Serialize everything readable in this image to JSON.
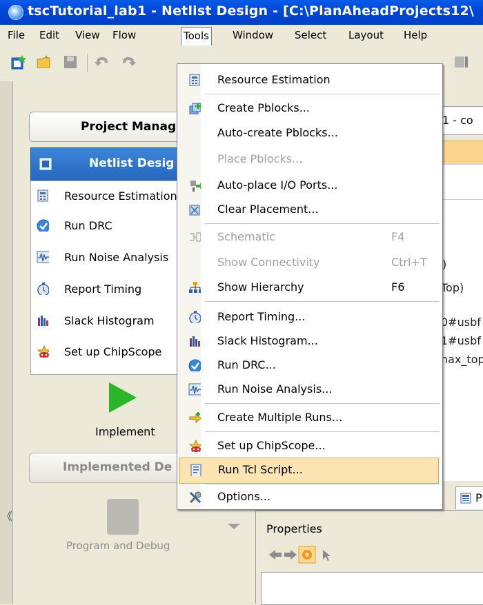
{
  "window": {
    "title": "tscTutorial_lab1 - Netlist Design - [C:\\PlanAheadProjects12\\"
  },
  "menubar": [
    "File",
    "Edit",
    "View",
    "Flow",
    "Tools",
    "Window",
    "Select",
    "Layout",
    "Help"
  ],
  "tools_menu": {
    "items": [
      {
        "label": "Resource Estimation",
        "icon": "resource-estimation-icon",
        "enabled": true
      },
      {
        "label": "Create Pblocks...",
        "icon": "create-pblocks-icon",
        "enabled": true
      },
      {
        "label": "Auto-create Pblocks...",
        "icon": "",
        "enabled": true
      },
      {
        "label": "Place Pblocks...",
        "icon": "",
        "enabled": false
      },
      {
        "label": "Auto-place I/O Ports...",
        "icon": "auto-place-io-icon",
        "enabled": true
      },
      {
        "label": "Clear Placement...",
        "icon": "clear-placement-icon",
        "enabled": true
      },
      {
        "label": "Schematic",
        "shortcut": "F4",
        "icon": "schematic-icon",
        "enabled": false
      },
      {
        "label": "Show Connectivity",
        "shortcut": "Ctrl+T",
        "icon": "",
        "enabled": false
      },
      {
        "label": "Show Hierarchy",
        "shortcut": "F6",
        "icon": "hierarchy-icon",
        "enabled": true
      },
      {
        "label": "Report Timing...",
        "icon": "stopwatch-icon",
        "enabled": true
      },
      {
        "label": "Slack Histogram...",
        "icon": "histogram-icon",
        "enabled": true
      },
      {
        "label": "Run DRC...",
        "icon": "checkmark-icon",
        "enabled": true
      },
      {
        "label": "Run Noise Analysis...",
        "icon": "noise-icon",
        "enabled": true
      },
      {
        "label": "Create Multiple Runs...",
        "icon": "multiple-runs-icon",
        "enabled": true
      },
      {
        "label": "Set up ChipScope...",
        "icon": "chipscope-icon",
        "enabled": true
      },
      {
        "label": "Run Tcl Script...",
        "icon": "tcl-script-icon",
        "enabled": true,
        "highlighted": true
      },
      {
        "label": "Options...",
        "icon": "options-icon",
        "enabled": true
      }
    ]
  },
  "left_panel": {
    "project_manager": "Project Manag",
    "netlist_design_header": "Netlist Desig",
    "netlist_items": [
      {
        "label": "Resource Estimation",
        "icon": "resource-estimation-icon"
      },
      {
        "label": "Run DRC",
        "icon": "checkmark-icon"
      },
      {
        "label": "Run Noise Analysis",
        "icon": "noise-icon"
      },
      {
        "label": "Report Timing",
        "icon": "stopwatch-icon"
      },
      {
        "label": "Slack Histogram",
        "icon": "histogram-icon"
      },
      {
        "label": "Set up ChipScope",
        "icon": "chipscope-icon"
      }
    ],
    "implement": "Implement",
    "implemented_design": "Implemented De",
    "program_and_debug": "Program and Debug"
  },
  "right_panel": {
    "tab_fragment": "1 - co",
    "content_lines": [
      ")",
      "Top)",
      "0#usbf",
      "1#usbf",
      "hax_top"
    ],
    "bottom_tab": "P",
    "properties_title": "Properties"
  },
  "colors": {
    "titlebar": "#0a5ae8",
    "menu_highlight": "#fde4b3",
    "panel_header": "#2f74cc",
    "implement_green": "#2ab52a"
  }
}
